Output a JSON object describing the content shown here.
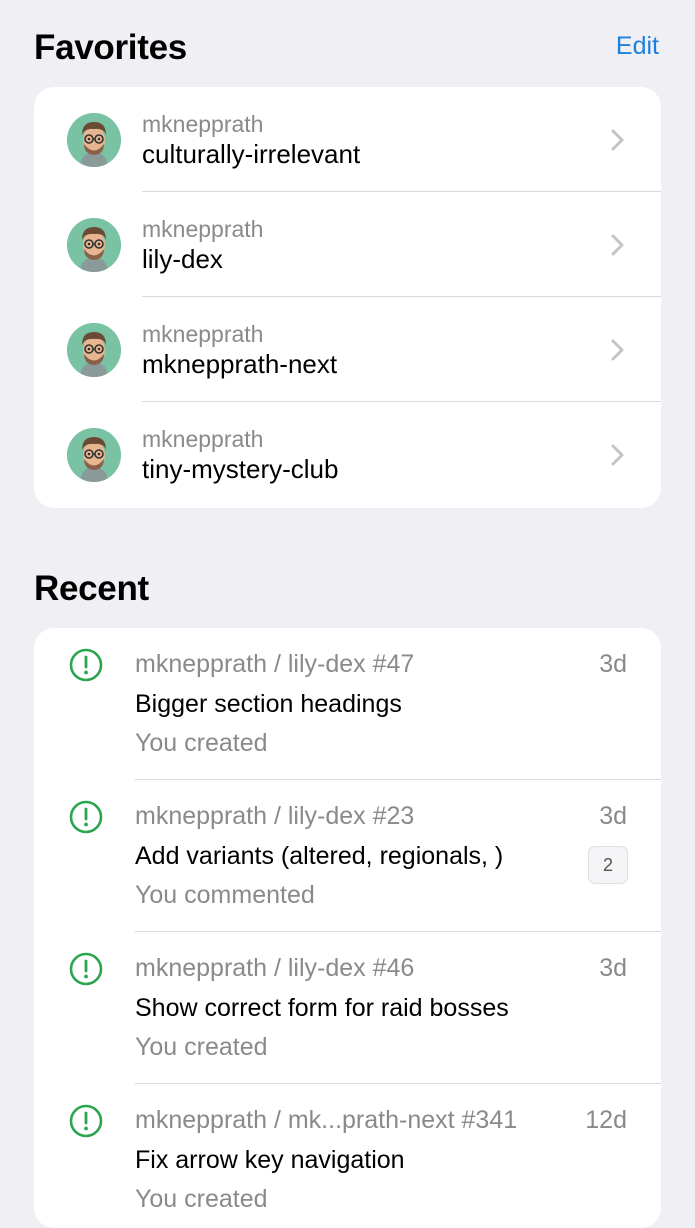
{
  "favorites": {
    "title": "Favorites",
    "edit_label": "Edit",
    "items": [
      {
        "owner": "mknepprath",
        "repo": "culturally-irrelevant"
      },
      {
        "owner": "mknepprath",
        "repo": "lily-dex"
      },
      {
        "owner": "mknepprath",
        "repo": "mknepprath-next"
      },
      {
        "owner": "mknepprath",
        "repo": "tiny-mystery-club"
      }
    ]
  },
  "recent": {
    "title": "Recent",
    "items": [
      {
        "meta": "mknepprath / lily-dex #47",
        "time": "3d",
        "title": "Bigger section headings",
        "sub": "You created",
        "badge": ""
      },
      {
        "meta": "mknepprath / lily-dex #23",
        "time": "3d",
        "title": "Add variants (altered, regionals, )",
        "sub": "You commented",
        "badge": "2"
      },
      {
        "meta": "mknepprath / lily-dex #46",
        "time": "3d",
        "title": "Show correct form for raid bosses",
        "sub": "You created",
        "badge": ""
      },
      {
        "meta": "mknepprath / mk...prath-next #341",
        "time": "12d",
        "title": "Fix arrow key navigation",
        "sub": "You created",
        "badge": ""
      }
    ]
  },
  "colors": {
    "accent": "#1f7fdc",
    "issue_open": "#2da44e",
    "avatar_bg": "#79c2a3",
    "background": "#efeff4"
  },
  "icons": {
    "avatar": "memoji-avatar-icon",
    "chevron": "chevron-right-icon",
    "issue": "issue-opened-icon"
  }
}
